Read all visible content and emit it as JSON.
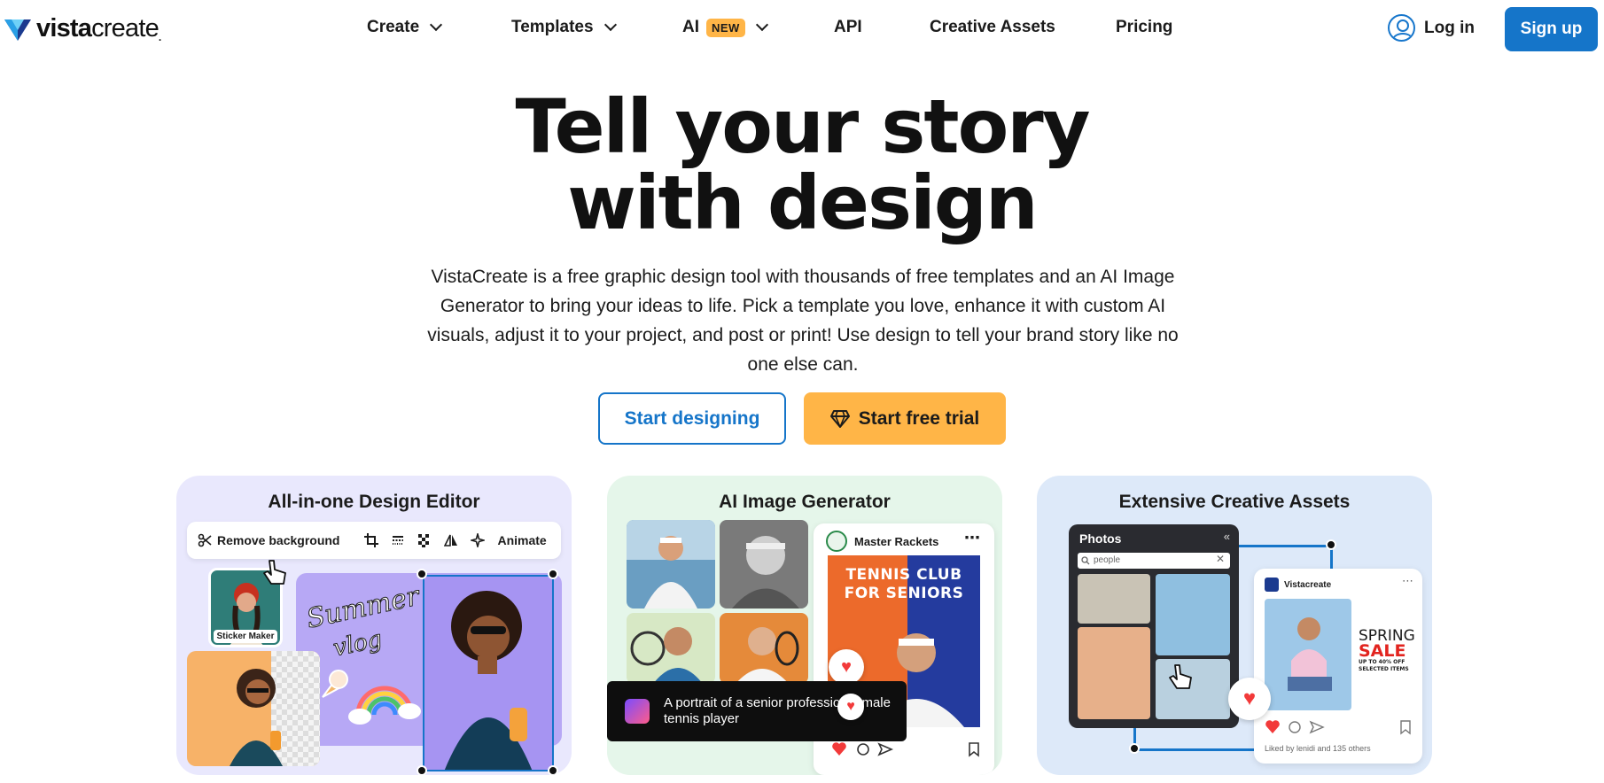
{
  "nav": {
    "logo_bold": "vista",
    "logo_light": "create",
    "logo_dot": ".",
    "items": [
      {
        "label": "Create",
        "has_chevron": true
      },
      {
        "label": "Templates",
        "has_chevron": true
      },
      {
        "label": "AI",
        "badge": "NEW",
        "has_chevron": true
      },
      {
        "label": "API"
      },
      {
        "label": "Creative Assets"
      },
      {
        "label": "Pricing"
      }
    ],
    "login_label": "Log in",
    "signup_label": "Sign up"
  },
  "hero": {
    "title_line1": "Tell your story",
    "title_line2": "with design",
    "description": "VistaCreate is a free graphic design tool with thousands of free templates and an AI Image Generator to bring your ideas to life. Pick a template you love, enhance it with custom AI visuals, adjust it to your project, and post or print! Use design to tell your brand story like no one else can.",
    "cta_primary": "Start designing",
    "cta_trial": "Start free trial"
  },
  "cards": {
    "editor": {
      "title": "All-in-one Design Editor",
      "toolbar_remove_bg": "Remove background",
      "toolbar_animate": "Animate",
      "sticker_label": "Sticker Maker",
      "summer_text_1": "Summer",
      "summer_text_2": "vlog"
    },
    "ai": {
      "title": "AI Image Generator",
      "post_account": "Master Rackets",
      "poster_line1": "TENNIS CLUB",
      "poster_line2": "FOR SENIORS",
      "prompt": "A portrait of a senior professional male tennis player"
    },
    "assets": {
      "title": "Extensive Creative Assets",
      "panel_title": "Photos",
      "search_value": "people",
      "ig_account": "Vistacreate",
      "sale_line1": "SPRING",
      "sale_line2": "SALE",
      "sale_line3": "UP TO 40% OFF",
      "sale_line4": "SELECTED ITEMS",
      "liked_by": "Liked by lenidi and 135 others"
    }
  },
  "colors": {
    "brand_blue": "#1575c9",
    "accent_orange": "#ffb547",
    "card_editor_bg": "#e9e8fd",
    "card_ai_bg": "#e5f6ea",
    "card_assets_bg": "#dde9f9"
  }
}
